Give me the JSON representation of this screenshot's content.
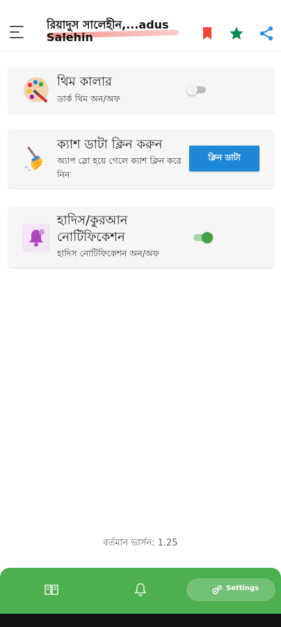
{
  "app_bar": {
    "title": "রিয়াদুস সালেহীন,...adus Salehin",
    "icons": [
      "menu-icon",
      "bookmark-icon",
      "star-icon",
      "share-icon"
    ],
    "colors": {
      "bookmark": "#f44336",
      "star": "#0f9d58",
      "share": "#1e88e5"
    }
  },
  "settings": {
    "theme": {
      "title": "থিম কালার",
      "subtitle": "ডার্ক থিম অন/অফ",
      "toggle_on": false
    },
    "cache": {
      "title": "ক্যাশ ডাটা ক্লিন করুন",
      "subtitle": "অ্যাপ স্লো হয়ে গেলে ক্যাশ ক্লিন করে নিন",
      "button_label": "ক্লিন ডাটা"
    },
    "notification": {
      "title": "হাদিস/কুরআন নোটিফিকেশন",
      "subtitle": "হাদিস নোটিফিকেশন অন/অফ",
      "toggle_on": true
    }
  },
  "version": "বর্তমান ভার্সন: 1.25",
  "bottom_nav": {
    "items": [
      {
        "icon": "book-icon"
      },
      {
        "icon": "bell-icon"
      },
      {
        "icon": "settings-icon",
        "label": "Settings",
        "active": true
      }
    ],
    "color": "#4caf50"
  }
}
